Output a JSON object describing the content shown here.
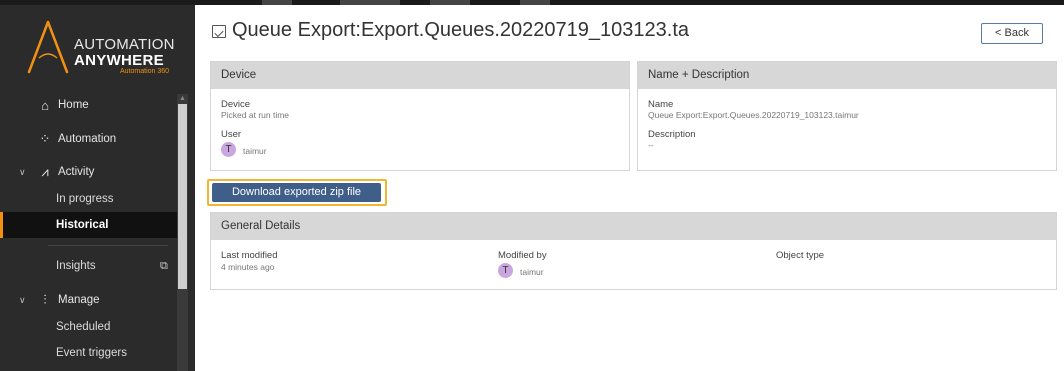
{
  "brand": {
    "line1": "AUTOMATION",
    "line2": "ANYWHERE",
    "tagline": "Automation 360",
    "accent": "#f29111"
  },
  "sidebar": {
    "items": [
      {
        "label": "Home",
        "icon": "home-icon"
      },
      {
        "label": "Automation",
        "icon": "automation-icon"
      },
      {
        "label": "Activity",
        "icon": "activity-icon",
        "expanded": true
      },
      {
        "label": "In progress"
      },
      {
        "label": "Historical",
        "active": true
      },
      {
        "label": "Insights",
        "external": true
      },
      {
        "label": "Manage",
        "icon": "manage-icon",
        "expanded": true
      },
      {
        "label": "Scheduled"
      },
      {
        "label": "Event triggers"
      }
    ]
  },
  "header": {
    "title": "Queue Export:Export.Queues.20220719_103123.ta",
    "back_label": "< Back"
  },
  "device_panel": {
    "header": "Device",
    "device_label": "Device",
    "device_value": "Picked at run time",
    "user_label": "User",
    "user_initial": "T",
    "user_name": "taimur"
  },
  "name_panel": {
    "header": "Name + Description",
    "name_label": "Name",
    "name_value": "Queue Export:Export.Queues.20220719_103123.taimur",
    "desc_label": "Description",
    "desc_value": "--"
  },
  "download_button": "Download exported zip file",
  "general_panel": {
    "header": "General Details",
    "last_modified_label": "Last modified",
    "last_modified_value": "4 minutes ago",
    "modified_by_label": "Modified by",
    "modified_by_initial": "T",
    "modified_by_name": "taimur",
    "object_type_label": "Object type"
  }
}
